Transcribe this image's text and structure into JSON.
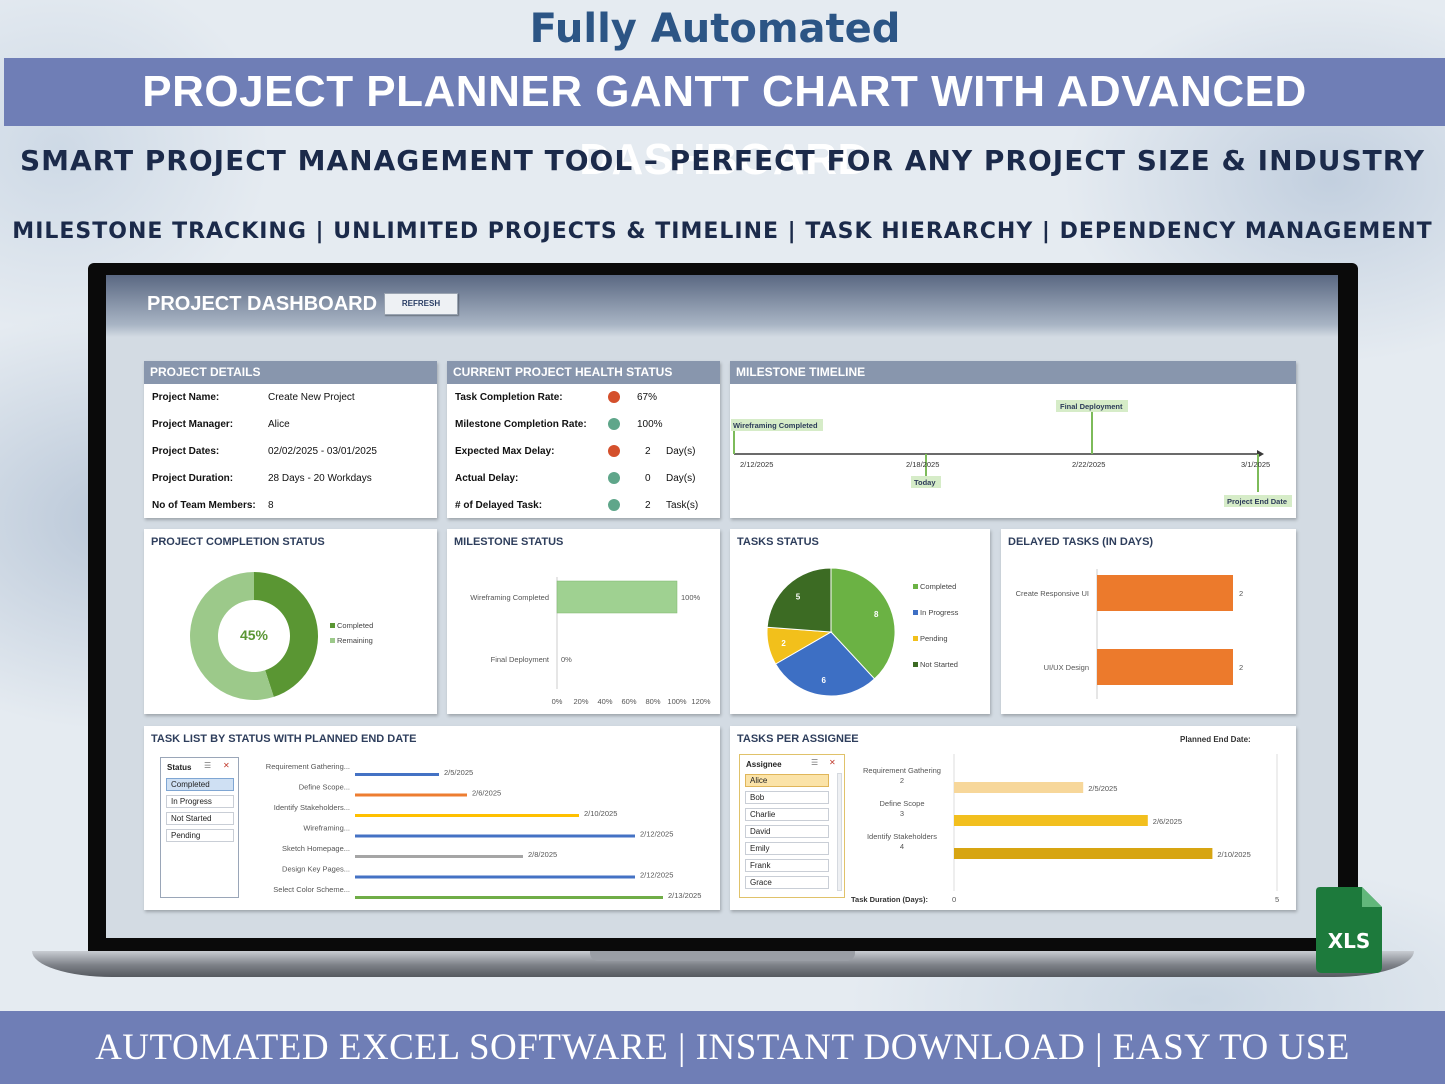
{
  "header": {
    "top_title": "Fully Automated",
    "banner": "PROJECT PLANNER GANTT CHART WITH ADVANCED DASHBOARD",
    "subtitle": "SMART PROJECT MANAGEMENT TOOL  – PERFECT FOR ANY PROJECT SIZE & INDUSTRY",
    "features": "MILESTONE TRACKING | UNLIMITED PROJECTS & TIMELINE | TASK HIERARCHY | DEPENDENCY MANAGEMENT"
  },
  "footer": {
    "text": "AUTOMATED EXCEL SOFTWARE   |   INSTANT DOWNLOAD   |   EASY TO USE"
  },
  "xls_badge": "XLS",
  "dashboard": {
    "title": "PROJECT DASHBOARD",
    "refresh_label": "REFRESH",
    "project_details": {
      "heading": "PROJECT DETAILS",
      "rows": [
        {
          "label": "Project Name:",
          "value": "Create New Project"
        },
        {
          "label": "Project Manager:",
          "value": "Alice"
        },
        {
          "label": "Project Dates:",
          "value": "02/02/2025 - 03/01/2025"
        },
        {
          "label": "Project Duration:",
          "value": "28 Days - 20 Workdays"
        },
        {
          "label": "No of Team Members:",
          "value": "8"
        }
      ]
    },
    "health": {
      "heading": "CURRENT PROJECT HEALTH STATUS",
      "rows": [
        {
          "label": "Task Completion Rate:",
          "status": "red",
          "value": "67%",
          "unit": ""
        },
        {
          "label": "Milestone Completion Rate:",
          "status": "green",
          "value": "100%",
          "unit": ""
        },
        {
          "label": "Expected Max Delay:",
          "status": "red",
          "value": "2",
          "unit": "Day(s)"
        },
        {
          "label": "Actual Delay:",
          "status": "green",
          "value": "0",
          "unit": "Day(s)"
        },
        {
          "label": "# of Delayed Task:",
          "status": "green",
          "value": "2",
          "unit": "Task(s)"
        }
      ],
      "colors": {
        "red": "#d4502c",
        "green": "#5fa68a"
      }
    },
    "milestone_timeline": {
      "heading": "MILESTONE TIMELINE",
      "ticks": [
        "2/12/2025",
        "2/18/2025",
        "2/22/2025",
        "3/1/2025"
      ],
      "milestones": {
        "wireframing": "Wireframing Completed",
        "final": "Final Deployment",
        "today": "Today",
        "end": "Project End Date"
      }
    },
    "completion": {
      "heading": "PROJECT COMPLETION STATUS",
      "center_label": "45%",
      "legend": [
        "Completed",
        "Remaining"
      ]
    },
    "milestone_status": {
      "heading": "MILESTONE STATUS",
      "axis": [
        "0%",
        "20%",
        "40%",
        "60%",
        "80%",
        "100%",
        "120%"
      ]
    },
    "tasks_status": {
      "heading": "TASKS STATUS"
    },
    "delayed_tasks": {
      "heading": "DELAYED TASKS (IN DAYS)"
    },
    "task_list": {
      "heading": "TASK LIST BY STATUS WITH PLANNED END DATE",
      "slicer_title": "Status",
      "slicer_items": [
        "Completed",
        "In Progress",
        "Not Started",
        "Pending"
      ]
    },
    "assignee": {
      "heading": "TASKS PER ASSIGNEE",
      "planned_label": "Planned End Date:",
      "duration_label": "Task Duration (Days):",
      "slicer_title": "Assignee",
      "slicer_items": [
        "Alice",
        "Bob",
        "Charlie",
        "David",
        "Emily",
        "Frank",
        "Grace"
      ]
    }
  },
  "chart_data": [
    {
      "type": "pie",
      "title": "PROJECT COMPLETION STATUS",
      "categories": [
        "Completed",
        "Remaining"
      ],
      "values": [
        45,
        55
      ],
      "colors": [
        "#5a9633",
        "#9cc98a"
      ]
    },
    {
      "type": "bar",
      "title": "MILESTONE STATUS",
      "categories": [
        "Wireframing Completed",
        "Final Deployment"
      ],
      "values": [
        100,
        0
      ],
      "value_labels": [
        "100%",
        "0%"
      ],
      "xlim": [
        0,
        120
      ],
      "color": "#9fd191"
    },
    {
      "type": "pie",
      "title": "TASKS STATUS",
      "categories": [
        "Completed",
        "In Progress",
        "Pending",
        "Not Started"
      ],
      "values": [
        8,
        6,
        2,
        5
      ],
      "colors": [
        "#6bb244",
        "#3d6fc4",
        "#f2c01b",
        "#3c6b23"
      ]
    },
    {
      "type": "bar",
      "title": "DELAYED TASKS (IN DAYS)",
      "categories": [
        "Create Responsive UI",
        "UI/UX Design"
      ],
      "values": [
        2,
        2
      ],
      "color": "#ec7a2c"
    },
    {
      "type": "bar",
      "title": "TASK LIST BY STATUS WITH PLANNED END DATE",
      "categories": [
        "Requirement Gathering...",
        "Define Scope...",
        "Identify Stakeholders...",
        "Wireframing...",
        "Sketch Homepage...",
        "Design Key Pages...",
        "Select Color Scheme..."
      ],
      "end_dates": [
        "2/5/2025",
        "2/6/2025",
        "2/10/2025",
        "2/12/2025",
        "2/8/2025",
        "2/12/2025",
        "2/13/2025"
      ],
      "start_dates": [
        "2/2/2025",
        "2/2/2025",
        "2/2/2025",
        "2/2/2025",
        "2/2/2025",
        "2/2/2025",
        "2/2/2025"
      ],
      "colors": [
        "#4472c4",
        "#ed7d31",
        "#ffc000",
        "#4472c4",
        "#a5a5a5",
        "#4472c4",
        "#70ad47"
      ]
    },
    {
      "type": "bar",
      "title": "TASKS PER ASSIGNEE",
      "categories": [
        "Requirement Gathering",
        "Define Scope",
        "Identify Stakeholders"
      ],
      "values": [
        2,
        3,
        4
      ],
      "end_dates": [
        "2/5/2025",
        "2/6/2025",
        "2/10/2025"
      ],
      "xlim": [
        0,
        5
      ],
      "colors": [
        "#f7d79a",
        "#f2bf1e",
        "#d7a512"
      ]
    }
  ]
}
